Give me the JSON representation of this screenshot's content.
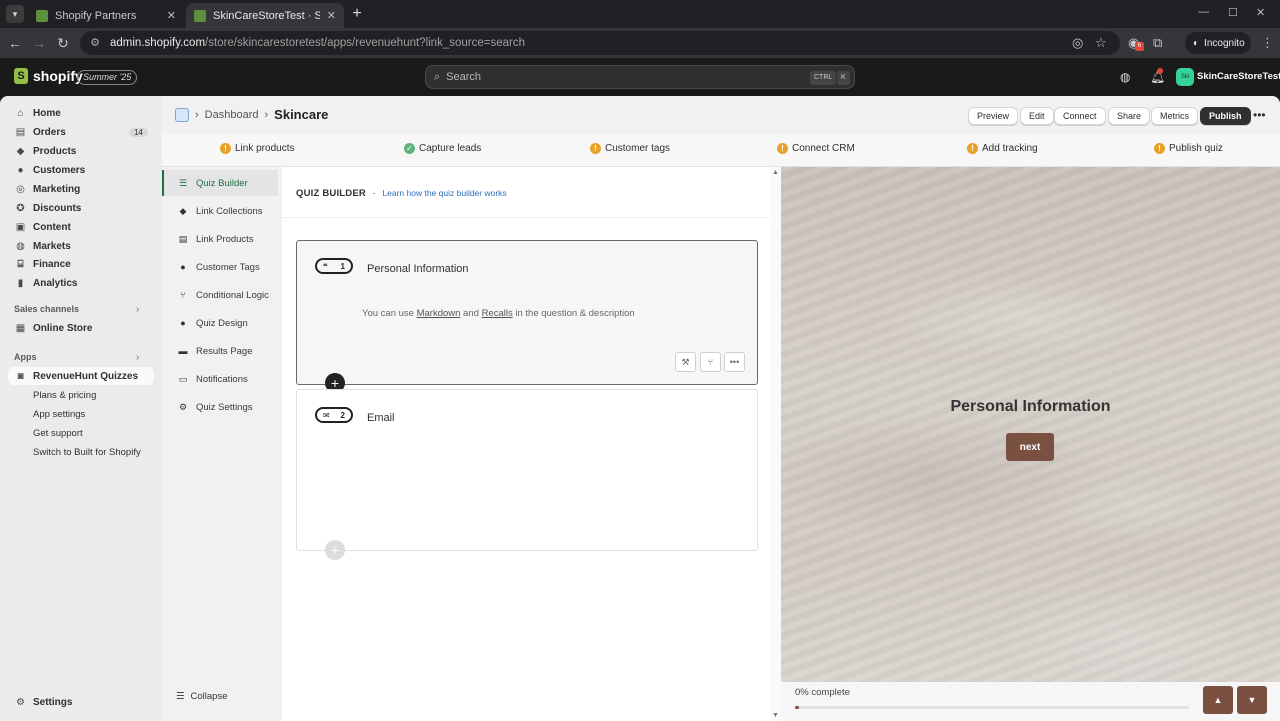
{
  "browser": {
    "tabs": [
      {
        "title": "Shopify Partners",
        "close": "✕"
      },
      {
        "title": "SkinCareStoreTest · Skincare · S",
        "close": "✕"
      }
    ],
    "new_tab": "+",
    "url_host": "admin.shopify.com",
    "url_path": "/store/skincarestoretest/apps/revenuehunt?link_source=search",
    "incognito_label": "Incognito",
    "ext_badge": "6"
  },
  "topbar": {
    "brand": "shopify",
    "edition": "Summer '25",
    "search_placeholder": "Search",
    "shortcut_ctrl": "CTRL",
    "shortcut_key": "K",
    "store_initials": "Ski",
    "store_name": "SkinCareStoreTest"
  },
  "nav": {
    "items": [
      {
        "label": "Home",
        "icon": "home-icon"
      },
      {
        "label": "Orders",
        "icon": "orders-icon",
        "count": "14"
      },
      {
        "label": "Products",
        "icon": "tag-icon"
      },
      {
        "label": "Customers",
        "icon": "person-icon"
      },
      {
        "label": "Marketing",
        "icon": "target-icon"
      },
      {
        "label": "Discounts",
        "icon": "discount-icon"
      },
      {
        "label": "Content",
        "icon": "content-icon"
      },
      {
        "label": "Markets",
        "icon": "globe-icon"
      },
      {
        "label": "Finance",
        "icon": "bank-icon"
      },
      {
        "label": "Analytics",
        "icon": "chart-icon"
      }
    ],
    "sales_channels_heading": "Sales channels",
    "online_store": "Online Store",
    "apps_heading": "Apps",
    "app_name": "RevenueHunt Quizzes",
    "app_subitems": [
      "Plans & pricing",
      "App settings",
      "Get support",
      "Switch to Built for Shopify"
    ],
    "settings": "Settings"
  },
  "header": {
    "crumb_parent": "Dashboard",
    "crumb_current": "Skincare",
    "buttons": {
      "preview": "Preview",
      "edit": "Edit",
      "connect": "Connect",
      "share": "Share",
      "metrics": "Metrics",
      "publish": "Publish"
    }
  },
  "steps": [
    {
      "label": "Link products",
      "status": "warning"
    },
    {
      "label": "Capture leads",
      "status": "done"
    },
    {
      "label": "Customer tags",
      "status": "warning"
    },
    {
      "label": "Connect CRM",
      "status": "warning"
    },
    {
      "label": "Add tracking",
      "status": "warning"
    },
    {
      "label": "Publish quiz",
      "status": "warning"
    }
  ],
  "builder_nav": [
    {
      "label": "Quiz Builder",
      "icon": "list-icon",
      "selected": true
    },
    {
      "label": "Link Collections",
      "icon": "tag-icon"
    },
    {
      "label": "Link Products",
      "icon": "box-icon"
    },
    {
      "label": "Customer Tags",
      "icon": "person-icon"
    },
    {
      "label": "Conditional Logic",
      "icon": "branch-icon"
    },
    {
      "label": "Quiz Design",
      "icon": "drop-icon"
    },
    {
      "label": "Results Page",
      "icon": "cart-icon"
    },
    {
      "label": "Notifications",
      "icon": "inbox-icon"
    },
    {
      "label": "Quiz Settings",
      "icon": "gear-icon"
    }
  ],
  "collapse_label": "Collapse",
  "builder": {
    "heading": "QUIZ BUILDER",
    "separator": "-",
    "help_link": "Learn how the quiz builder works",
    "questions": [
      {
        "number": "1",
        "title": "Personal Information",
        "type_icon": "quote-icon",
        "desc_pre": "You can use ",
        "desc_link1": "Markdown",
        "desc_mid": " and ",
        "desc_link2": "Recalls",
        "desc_post": " in the question & description"
      },
      {
        "number": "2",
        "title": "Email",
        "type_icon": "mail-icon"
      }
    ],
    "add_symbol": "+"
  },
  "preview": {
    "title": "Personal Information",
    "next": "next",
    "progress_label": "0% complete",
    "progress": 0.0
  },
  "colors": {
    "accent": "#7a5041",
    "nav_selected": "#1f6f43",
    "warning": "#e6a128",
    "success": "#5fb37a"
  }
}
